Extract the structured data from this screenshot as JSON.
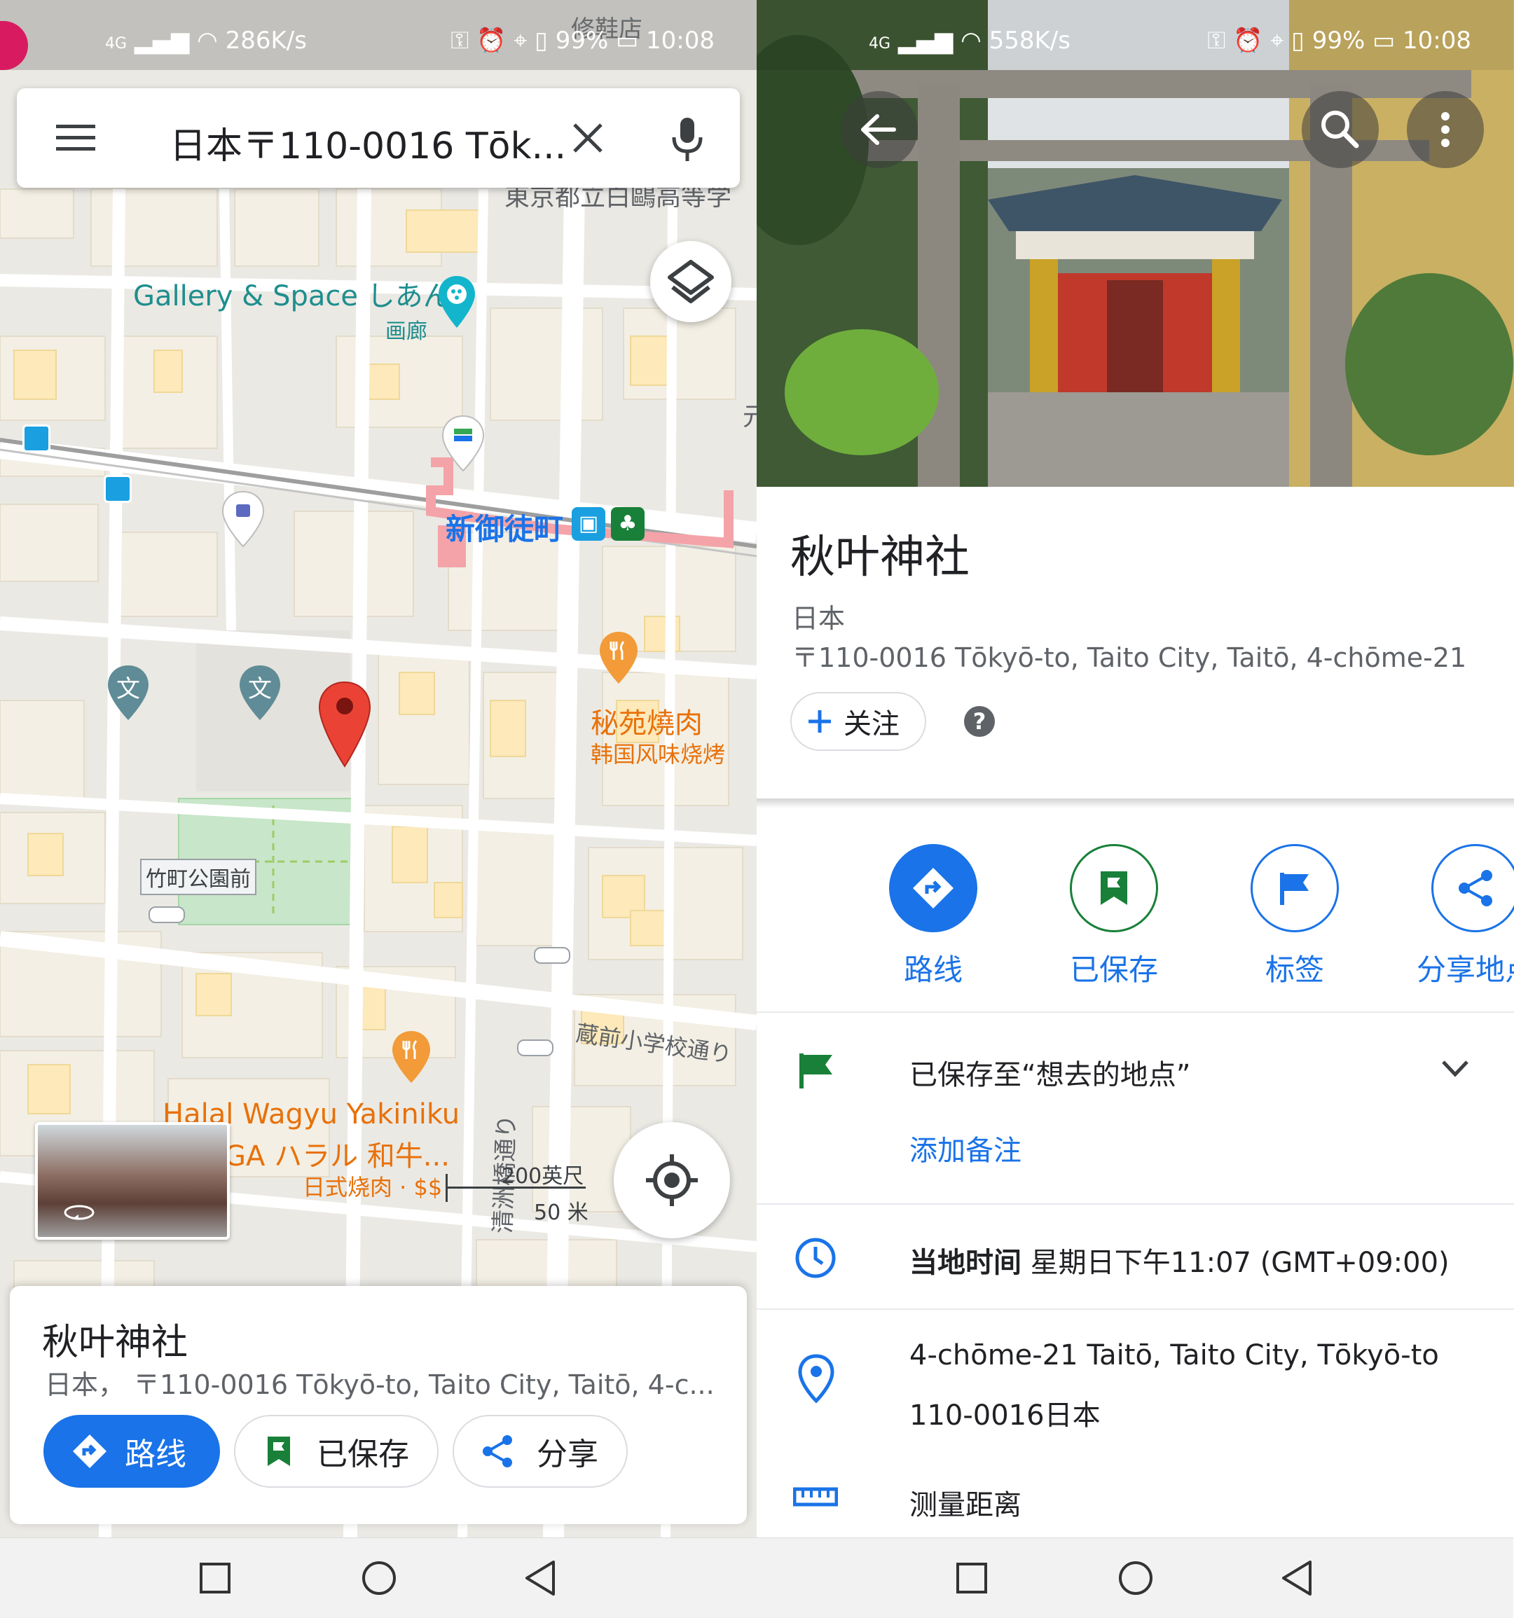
{
  "left": {
    "status": {
      "network": "4G",
      "speed": "286K/s",
      "battery": "99%",
      "time": "10:08"
    },
    "search": {
      "query": "日本〒110-0016 Tōk..."
    },
    "map_labels": {
      "shop_top": "修鞋店",
      "school_top": "東京都立白鷗高等学",
      "gallery_name": "Gallery & Space しあん",
      "gallery_type": "画廊",
      "station": "新御徒町",
      "restaurant1_name": "秘苑燒肉",
      "restaurant1_type": "韩国风味烧烤",
      "park_stop": "竹町公園前",
      "street_kuramae": "蔵前小学校通り",
      "street_kiyosu": "清洲橋通り",
      "restaurant2_name": "Halal Wagyu Yakiniku",
      "restaurant2_sub": "GA ハラル 和牛...",
      "restaurant2_type": "日式烧肉 · $$",
      "school_icon_1": "文",
      "school_icon_2": "文",
      "edge_char": "元"
    },
    "scale": {
      "feet": "200英尺",
      "meters": "50 米"
    },
    "card": {
      "title": "秋叶神社",
      "address": "日本， 〒110-0016 Tōkyō-to, Taito City, Taitō, 4-c...",
      "directions": "路线",
      "saved": "已保存",
      "share": "分享"
    }
  },
  "right": {
    "status": {
      "network": "4G",
      "speed": "558K/s",
      "battery": "99%",
      "time": "10:08"
    },
    "place": {
      "title": "秋叶神社",
      "country": "日本",
      "address": "〒110-0016 Tōkyō-to, Taito City, Taitō, 4-chōme-21",
      "follow": "关注",
      "help": "?"
    },
    "actions": {
      "directions": "路线",
      "saved": "已保存",
      "label": "标签",
      "share": "分享地点"
    },
    "saved_list": {
      "text": "已保存至“想去的地点”",
      "add_note": "添加备注"
    },
    "local_time": {
      "label": "当地时间",
      "value": "星期日下午11:07 (GMT+09:00)"
    },
    "address_full": {
      "line1": "4-chōme-21 Taitō, Taito City, Tōkyō-to",
      "line2": "110-0016日本"
    },
    "measure": "测量距离"
  },
  "colors": {
    "accent": "#1a73e8",
    "pin": "#ea4335",
    "saved_green": "#188038",
    "restaurant": "#f29b38",
    "school": "#5f8c96"
  }
}
